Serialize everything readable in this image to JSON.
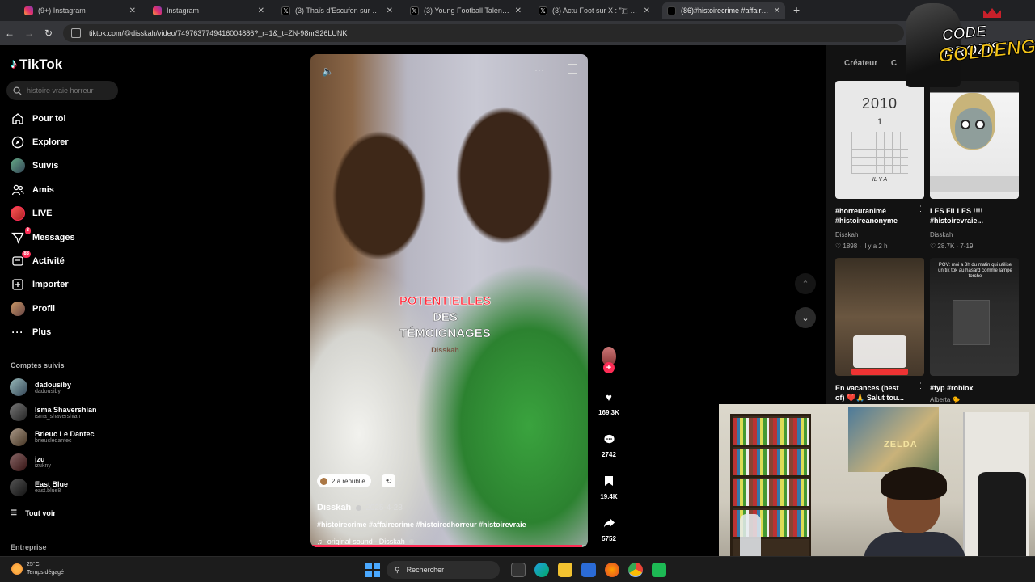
{
  "browser": {
    "tabs": [
      {
        "label": "(9+) Instagram",
        "icon": "instagram-icon",
        "active": false
      },
      {
        "label": "Instagram",
        "icon": "instagram-icon",
        "active": false
      },
      {
        "label": "(3) Thaïs d'Escufon sur X : \"Alors",
        "icon": "x-icon",
        "active": false
      },
      {
        "label": "(3) Young Football Talent sur X",
        "icon": "x-icon",
        "active": false
      },
      {
        "label": "(3) Actu Foot sur X : \"🇫 L'A",
        "icon": "x-icon",
        "active": false
      },
      {
        "label": "(86)#histoirecrime #affairecrim",
        "icon": "tiktok-icon",
        "active": true
      }
    ],
    "url": "tiktok.com/@disskah/video/7497637749416004886?_r=1&_t=ZN-98nrS26LUNK"
  },
  "tiktok": {
    "logo": "TikTok",
    "search_placeholder": "histoire vraie horreur",
    "nav": [
      {
        "label": "Pour toi",
        "icon": "home-icon"
      },
      {
        "label": "Explorer",
        "icon": "compass-icon"
      },
      {
        "label": "Suivis",
        "icon": "following-avatar"
      },
      {
        "label": "Amis",
        "icon": "friends-icon"
      },
      {
        "label": "LIVE",
        "icon": "live-avatar"
      },
      {
        "label": "Messages",
        "icon": "messages-icon",
        "badge": "3"
      },
      {
        "label": "Activité",
        "icon": "activity-icon",
        "badge": "83"
      },
      {
        "label": "Importer",
        "icon": "upload-icon"
      },
      {
        "label": "Profil",
        "icon": "profile-avatar"
      },
      {
        "label": "Plus",
        "icon": "more-icon"
      }
    ],
    "followed_title": "Comptes suivis",
    "followed": [
      {
        "name": "dadousiby",
        "user": "dadousiby"
      },
      {
        "name": "Isma Shavershian",
        "user": "isma_shavershian"
      },
      {
        "name": "Brieuc Le Dantec",
        "user": "brieucledantec"
      },
      {
        "name": "izu",
        "user": "izukny"
      },
      {
        "name": "East Blue",
        "user": "east.blue8"
      }
    ],
    "see_all": "Tout voir",
    "enterprise": "Entreprise",
    "video": {
      "caption_line1": "POTENTIELLES",
      "caption_line2": "DES",
      "caption_line3": "TÉMOIGNAGES",
      "caption_watermark": "Disskah",
      "repost_label": "2 a republié",
      "author": "Disskah",
      "date": "2025-4-28",
      "hashtags": "#histoirecrime #affairecrime #histoiredhorreur #histoirevraie",
      "sound": "original sound - Disskah",
      "progress": 0.98
    },
    "actions": {
      "likes": "169.3K",
      "comments": "2742",
      "saves": "19.4K",
      "shares": "5752"
    },
    "right_panel": {
      "tab": "Créateur",
      "tab2": "C",
      "items": [
        {
          "title1": "#horreuranimé",
          "title2": "#histoireanonyme",
          "author": "Disskah",
          "meta": "1898 · Il y a 2 h",
          "thumb_year": "2010",
          "thumb_num": "1",
          "thumb_caption": "IL Y A"
        },
        {
          "title1": "LES FILLES !!!!",
          "title2": "#histoirevraie...",
          "author": "Disskah",
          "meta": "28.7K · 7-19"
        },
        {
          "title1": "En vacances (best",
          "title2": "of) ❤️🙏 Salut tou...",
          "author": "",
          "meta": ""
        },
        {
          "title1": "#fyp #roblox",
          "title2": "",
          "author": "Alberta 🐤",
          "meta": "",
          "thumb_text": "POV: moi a 3h du matin qui utilise un tik tok au hasard comme lampe torche"
        }
      ]
    }
  },
  "overlay": {
    "brand_line1": "CODE PROZIS",
    "brand_line2": "GOLDENG",
    "poster_text": "ZELDA"
  },
  "taskbar": {
    "temp": "25°C",
    "weather": "Temps dégagé",
    "search": "Rechercher"
  }
}
